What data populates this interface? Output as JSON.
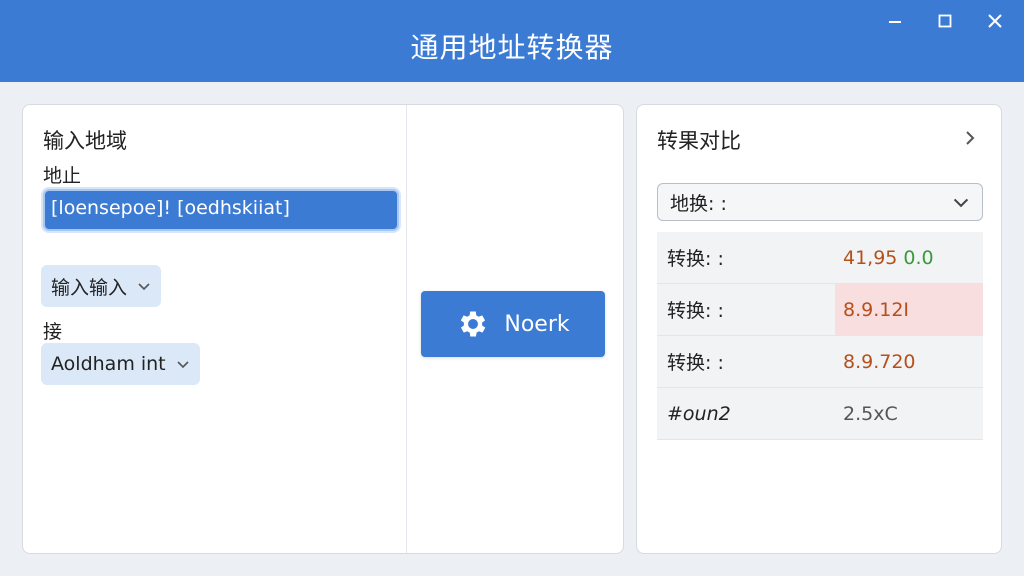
{
  "window": {
    "title": "通用地址转换器",
    "controls": {
      "minimize": "—",
      "maximize": "☐",
      "close": "✕"
    }
  },
  "input_panel": {
    "heading": "输入地域",
    "address_label": "地止",
    "address_value": "[loensepoe]! [oedhskiiat]",
    "first_select": "输入输入",
    "second_label": "接",
    "second_select": "Aoldham int"
  },
  "action": {
    "button_label": "Noerk",
    "icon": "gear-icon"
  },
  "compare_panel": {
    "heading": "转果对比",
    "dropdown_label": "地换: :",
    "rows": [
      {
        "key": "转换: :",
        "value": "41,95",
        "extra": "0.0"
      },
      {
        "key": "转换: :",
        "value": "8.9.12I",
        "extra": ""
      },
      {
        "key": "转换: :",
        "value": "8.9.720",
        "extra": ""
      },
      {
        "key": "#oun2",
        "value": "2.5xC",
        "extra": ""
      }
    ]
  },
  "colors": {
    "accent": "#3b7bd4",
    "value_text": "#b5501c",
    "positive": "#3a9a3a",
    "highlight_row": "#f8dede"
  }
}
